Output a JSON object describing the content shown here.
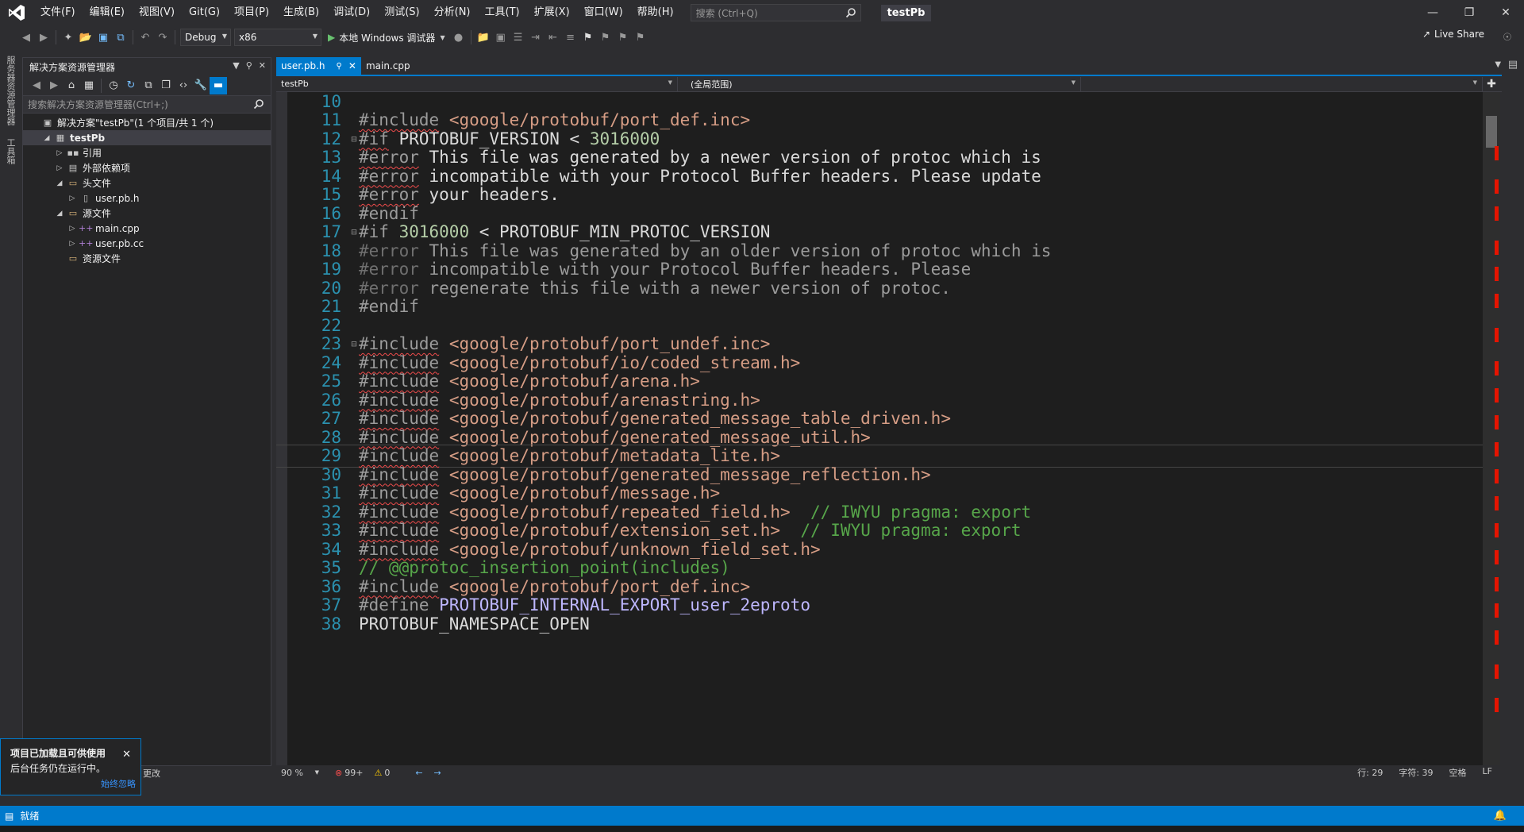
{
  "menu": [
    "文件(F)",
    "编辑(E)",
    "视图(V)",
    "Git(G)",
    "项目(P)",
    "生成(B)",
    "调试(D)",
    "测试(S)",
    "分析(N)",
    "工具(T)",
    "扩展(X)",
    "窗口(W)",
    "帮助(H)"
  ],
  "search": {
    "placeholder": "搜索 (Ctrl+Q)"
  },
  "solution_title": "testPb",
  "toolbar": {
    "config": "Debug",
    "platform": "x86",
    "debugger": "本地 Windows 调试器",
    "live_share": "Live Share"
  },
  "left_rail": [
    "服务器资源管理器",
    "工具箱"
  ],
  "solution_explorer": {
    "title": "解决方案资源管理器",
    "search_placeholder": "搜索解决方案资源管理器(Ctrl+;)",
    "tree": [
      {
        "label": "解决方案\"testPb\"(1 个项目/共 1 个)",
        "icon": "solution-icon",
        "glyph": "▣",
        "indent": 0,
        "twisty": ""
      },
      {
        "label": "testPb",
        "icon": "project-icon",
        "glyph": "▦",
        "indent": 1,
        "twisty": "◢",
        "bold": true
      },
      {
        "label": "引用",
        "icon": "references-icon",
        "glyph": "▪▪",
        "indent": 2,
        "twisty": "▷"
      },
      {
        "label": "外部依赖项",
        "icon": "dependencies-icon",
        "glyph": "▤",
        "indent": 2,
        "twisty": "▷"
      },
      {
        "label": "头文件",
        "icon": "folder-icon",
        "glyph": "▭",
        "indent": 2,
        "twisty": "◢"
      },
      {
        "label": "user.pb.h",
        "icon": "header-file-icon",
        "glyph": "▯",
        "indent": 3,
        "twisty": "▷"
      },
      {
        "label": "源文件",
        "icon": "folder-icon",
        "glyph": "▭",
        "indent": 2,
        "twisty": "◢"
      },
      {
        "label": "main.cpp",
        "icon": "cpp-file-icon",
        "glyph": "++",
        "indent": 3,
        "twisty": "▷"
      },
      {
        "label": "user.pb.cc",
        "icon": "cpp-file-icon",
        "glyph": "++",
        "indent": 3,
        "twisty": "▷"
      },
      {
        "label": "资源文件",
        "icon": "folder-icon",
        "glyph": "▭",
        "indent": 2,
        "twisty": ""
      }
    ]
  },
  "tabs": [
    {
      "label": "user.pb.h",
      "active": true
    },
    {
      "label": "main.cpp",
      "active": false
    }
  ],
  "navbar": {
    "project": "testPb",
    "scope": "(全局范围)",
    "member": ""
  },
  "code_lines": [
    {
      "n": "10",
      "fold": "",
      "html": ""
    },
    {
      "n": "11",
      "fold": "",
      "html": "<span class='pp'>#include</span> <span class='str-o'>&lt;google/protobuf/port_def.inc&gt;</span>"
    },
    {
      "n": "12",
      "fold": "⊟",
      "html": "<span class='pp'>#if</span> PROTOBUF_VERSION &lt; <span class='num'>3016000</span>"
    },
    {
      "n": "13",
      "fold": "",
      "html": "<span class='pp'>#error</span> This file was generated by a newer version of protoc which is"
    },
    {
      "n": "14",
      "fold": "",
      "html": "<span class='pp'>#error</span> incompatible with your Protocol Buffer headers. Please update"
    },
    {
      "n": "15",
      "fold": "",
      "html": "<span class='pp'>#error</span> your headers."
    },
    {
      "n": "16",
      "fold": "",
      "html": "<span class='err-dim'>#endif</span>"
    },
    {
      "n": "17",
      "fold": "⊟",
      "html": "<span class='err-dim'>#if</span> <span class='num'>3016000</span> &lt; PROTOBUF_MIN_PROTOC_VERSION"
    },
    {
      "n": "18",
      "fold": "",
      "html": "<span class='pp-dim'>#error</span> <span class='txt-dim'>This file was generated by an older version of protoc which is</span>"
    },
    {
      "n": "19",
      "fold": "",
      "html": "<span class='pp-dim'>#error</span> <span class='txt-dim'>incompatible with your Protocol Buffer headers. Please</span>"
    },
    {
      "n": "20",
      "fold": "",
      "html": "<span class='pp-dim'>#error</span> <span class='txt-dim'>regenerate this file with a newer version of protoc.</span>"
    },
    {
      "n": "21",
      "fold": "",
      "html": "<span class='err-dim'>#endif</span>"
    },
    {
      "n": "22",
      "fold": "",
      "html": ""
    },
    {
      "n": "23",
      "fold": "⊟",
      "html": "<span class='pp'>#include</span> <span class='str-o'>&lt;google/protobuf/port_undef.inc&gt;</span>"
    },
    {
      "n": "24",
      "fold": "",
      "html": "<span class='pp'>#include</span> <span class='str-o'>&lt;google/protobuf/io/coded_stream.h&gt;</span>"
    },
    {
      "n": "25",
      "fold": "",
      "html": "<span class='pp'>#include</span> <span class='str-o'>&lt;google/protobuf/arena.h&gt;</span>"
    },
    {
      "n": "26",
      "fold": "",
      "html": "<span class='pp'>#include</span> <span class='str-o'>&lt;google/protobuf/arenastring.h&gt;</span>"
    },
    {
      "n": "27",
      "fold": "",
      "html": "<span class='pp'>#include</span> <span class='str-o'>&lt;google/protobuf/generated_message_table_driven.h&gt;</span>"
    },
    {
      "n": "28",
      "fold": "",
      "html": "<span class='pp'>#include</span> <span class='str-o'>&lt;google/protobuf/generated_message_util.h&gt;</span>"
    },
    {
      "n": "29",
      "fold": "",
      "html": "<span class='pp'>#include</span> <span class='str-o'>&lt;google/protobuf/metadata_lite.h&gt;</span>",
      "current": true
    },
    {
      "n": "30",
      "fold": "",
      "html": "<span class='pp'>#include</span> <span class='str-o'>&lt;google/protobuf/generated_message_reflection.h&gt;</span>"
    },
    {
      "n": "31",
      "fold": "",
      "html": "<span class='pp'>#include</span> <span class='str-o'>&lt;google/protobuf/message.h&gt;</span>"
    },
    {
      "n": "32",
      "fold": "",
      "html": "<span class='pp'>#include</span> <span class='str-o'>&lt;google/protobuf/repeated_field.h&gt;</span>  <span class='cm'>// IWYU pragma: export</span>"
    },
    {
      "n": "33",
      "fold": "",
      "html": "<span class='pp'>#include</span> <span class='str-o'>&lt;google/protobuf/extension_set.h&gt;</span>  <span class='cm'>// IWYU pragma: export</span>"
    },
    {
      "n": "34",
      "fold": "",
      "html": "<span class='pp'>#include</span> <span class='str-o'>&lt;google/protobuf/unknown_field_set.h&gt;</span>"
    },
    {
      "n": "35",
      "fold": "",
      "html": "<span class='cm'>// @@protoc_insertion_point(includes)</span>"
    },
    {
      "n": "36",
      "fold": "",
      "html": "<span class='pp'>#include</span> <span class='str-o'>&lt;google/protobuf/port_def.inc&gt;</span>"
    },
    {
      "n": "37",
      "fold": "",
      "html": "<span class='err-dim'>#define</span> <span class='mac'>PROTOBUF_INTERNAL_EXPORT_user_2eproto</span>"
    },
    {
      "n": "38",
      "fold": "",
      "html": "PROTOBUF_NAMESPACE_OPEN"
    }
  ],
  "error_marks": [
    0.08,
    0.13,
    0.17,
    0.22,
    0.26,
    0.3,
    0.35,
    0.4,
    0.44,
    0.48,
    0.52,
    0.56,
    0.6,
    0.64,
    0.68,
    0.72,
    0.76,
    0.8,
    0.85,
    0.9
  ],
  "editor_bottom": {
    "zoom": "90 %",
    "errors": "99+",
    "warnings": "0",
    "line": "行: 29",
    "col": "字符: 39",
    "spaces": "空格",
    "eol": "LF"
  },
  "notification": {
    "title": "项目已加载且可供使用",
    "body": "后台任务仍在运行中。",
    "link": "始终忽略"
  },
  "changes_label": "更改",
  "status": {
    "text": "就绪"
  }
}
